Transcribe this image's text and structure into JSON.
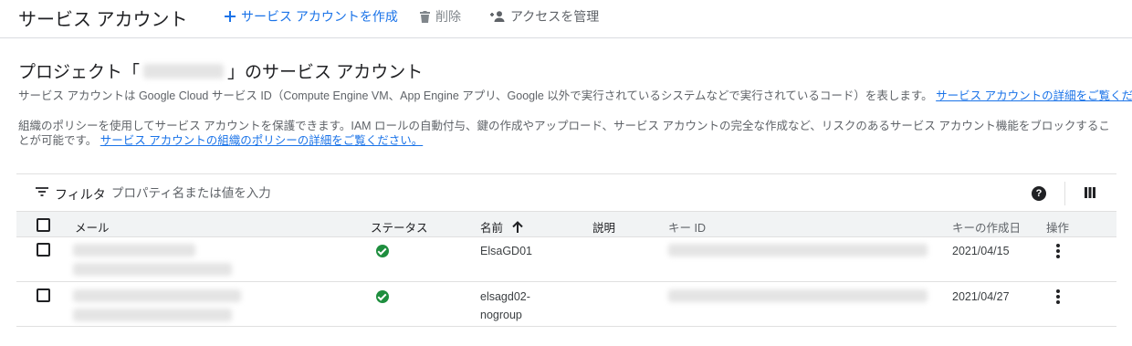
{
  "header": {
    "title": "サービス アカウント",
    "create_label": "サービス アカウントを作成",
    "delete_label": "削除",
    "manage_access_label": "アクセスを管理"
  },
  "page": {
    "heading_prefix": "プロジェクト「",
    "heading_suffix": "」のサービス アカウント",
    "description_1": "サービス アカウントは Google Cloud サービス ID（Compute Engine VM、App Engine アプリ、Google 以外で実行されているシステムなどで実行されているコード）を表します。",
    "description_1_link": "サービス アカウントの詳細をご覧ください。",
    "description_2": "組織のポリシーを使用してサービス アカウントを保護できます。IAM ロールの自動付与、鍵の作成やアップロード、サービス アカウントの完全な作成など、リスクのあるサービス アカウント機能をブロックすることが可能です。",
    "description_2_link": "サービス アカウントの組織のポリシーの詳細をご覧ください。"
  },
  "filter": {
    "label": "フィルタ",
    "placeholder": "プロパティ名または値を入力"
  },
  "table": {
    "columns": {
      "email": "メール",
      "status": "ステータス",
      "name": "名前",
      "description": "説明",
      "key_id": "キー ID",
      "key_created": "キーの作成日",
      "actions": "操作"
    },
    "rows": [
      {
        "name": "ElsaGD01",
        "key_created": "2021/04/15"
      },
      {
        "name_line1": "elsagd02-",
        "name_line2": "nogroup",
        "key_created": "2021/04/27"
      }
    ]
  },
  "colors": {
    "accent": "#1a73e8",
    "status_ok": "#1e8e3e",
    "divider": "#dadce0"
  }
}
